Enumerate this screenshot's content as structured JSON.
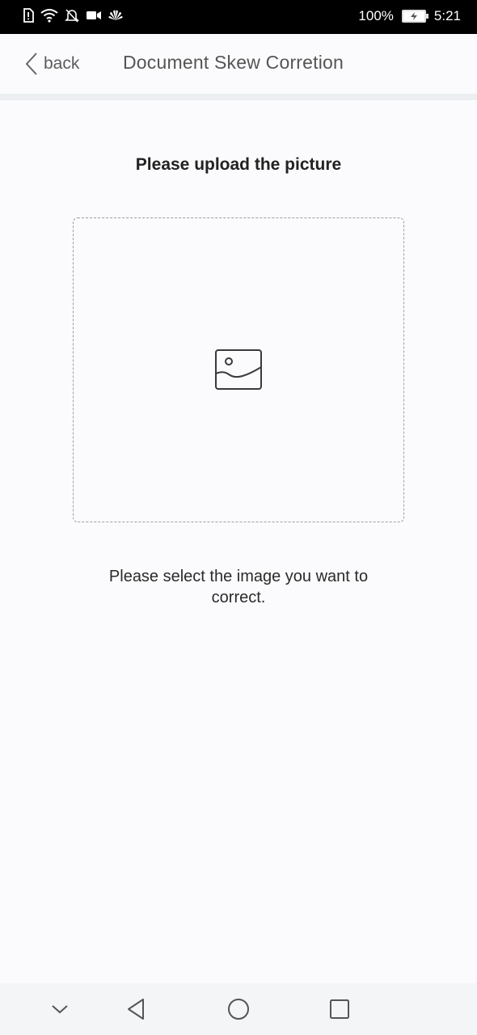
{
  "status_bar": {
    "battery": "100%",
    "time": "5:21",
    "icons": [
      "sim-alert-icon",
      "wifi-icon",
      "mute-icon",
      "video-icon",
      "huawei-icon"
    ]
  },
  "header": {
    "back_label": "back",
    "title": "Document Skew Corretion"
  },
  "upload": {
    "heading": "Please upload the picture",
    "icon": "image-placeholder-icon",
    "hint": "Please select the image you want to correct."
  },
  "nav": {
    "buttons": [
      "nav-down-icon",
      "nav-back-icon",
      "nav-home-icon",
      "nav-recents-icon"
    ]
  },
  "colors": {
    "background": "#fbfbfd",
    "status_bar": "#000000",
    "text_primary": "#222222",
    "text_secondary": "#555555"
  }
}
